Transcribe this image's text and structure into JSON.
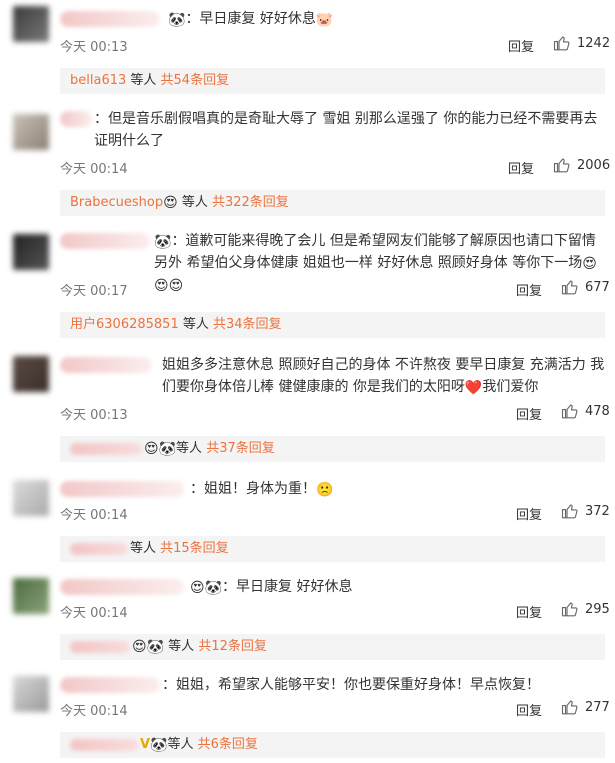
{
  "comments": [
    {
      "text_lead": "：早日康复 好好休息",
      "time": "今天 00:13",
      "reply_label": "回复",
      "likes": "1242",
      "sub": {
        "user": "bella613",
        "mid": " 等人 ",
        "count": "共54条回复"
      }
    },
    {
      "text_lead": "：但是音乐剧假唱真的是奇耻大辱了 雪姐 别那么逞强了 你的能力已经不需要再去证明什么了",
      "time": "今天 00:14",
      "reply_label": "回复",
      "likes": "2006",
      "sub": {
        "user": "Brabecueshop",
        "mid": " 等人 ",
        "count": "共322条回复"
      }
    },
    {
      "text_lead": "：道歉可能来得晚了会儿 但是希望网友们能够了解原因也请口下留情 另外 希望伯父身体健康 姐姐也一样 好好休息 照顾好身体 等你下一场",
      "time": "今天 00:17",
      "reply_label": "回复",
      "likes": "677",
      "sub": {
        "user": "用户6306285851",
        "mid": " 等人 ",
        "count": "共34条回复"
      }
    },
    {
      "text_lead": "姐姐多多注意休息 照顾好自己的身体 不许熬夜 要早日康复 充满活力 我们要你身体倍儿棒 健健康康的 你是我们的太阳呀",
      "text_tail": "我们爱你",
      "time": "今天 00:13",
      "reply_label": "回复",
      "likes": "478",
      "sub": {
        "user": "",
        "mid": "等人 ",
        "count": "共37条回复"
      }
    },
    {
      "text_lead": "：姐姐！身体为重！",
      "time": "今天 00:14",
      "reply_label": "回复",
      "likes": "372",
      "sub": {
        "user": "",
        "mid": "等人 ",
        "count": "共15条回复"
      }
    },
    {
      "text_lead": "：早日康复 好好休息",
      "time": "今天 00:14",
      "reply_label": "回复",
      "likes": "295",
      "sub": {
        "user": "",
        "mid": " 等人 ",
        "count": "共12条回复"
      }
    },
    {
      "text_lead": "：姐姐，希望家人能够平安！你也要保重好身体！早点恢复！",
      "time": "今天 00:14",
      "reply_label": "回复",
      "likes": "277",
      "sub": {
        "user": "",
        "mid": "等人 ",
        "count": "共6条回复"
      }
    }
  ],
  "emoji": {
    "panda": "🐼",
    "pig": "🐷",
    "heart": "❤️",
    "sad": "🙁",
    "hearts_face": "😍",
    "v": "V"
  },
  "colors": {
    "accent": "#eb7340",
    "link": "#eb7340",
    "sub_bg": "#f4f4f4"
  }
}
